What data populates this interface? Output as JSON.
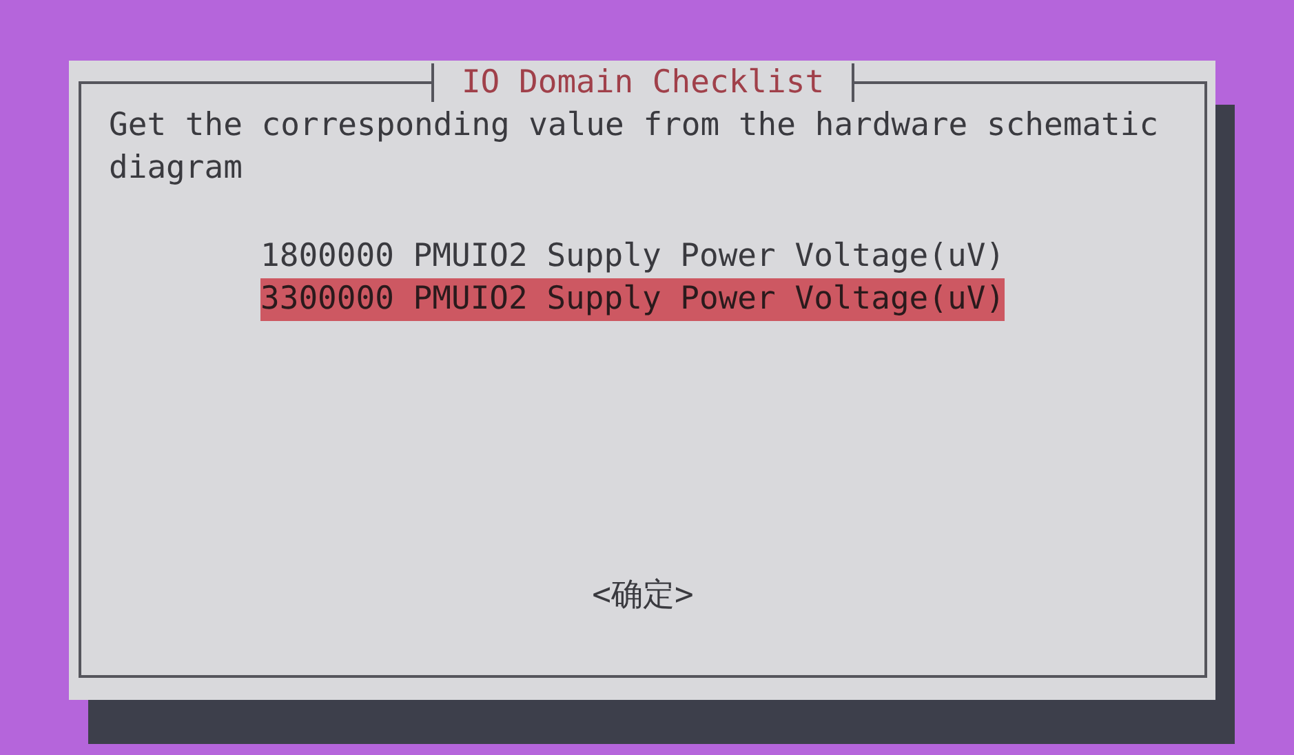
{
  "dialog": {
    "title": "IO Domain Checklist",
    "message": "Get the corresponding value from the hardware schematic diagram",
    "options": [
      {
        "label": "1800000 PMUIO2 Supply Power Voltage(uV)",
        "selected": false
      },
      {
        "label": "3300000 PMUIO2 Supply Power Voltage(uV)",
        "selected": true
      }
    ],
    "buttons": [
      "<确定>"
    ]
  }
}
